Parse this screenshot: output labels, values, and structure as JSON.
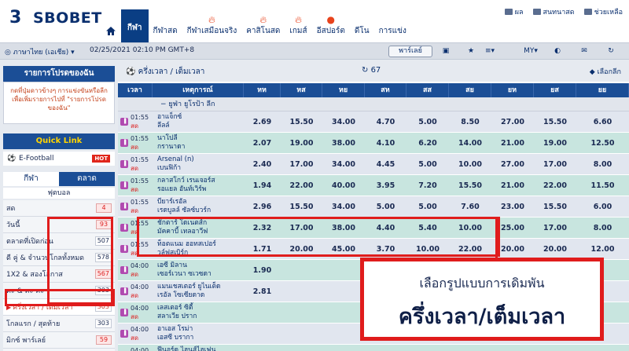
{
  "header": {
    "logo_mark": "3",
    "logo_text": "SBOBET",
    "nav": [
      {
        "label": "กีฬา",
        "active": true
      },
      {
        "label": "กีฬาสด"
      },
      {
        "label": "กีฬาเสมือนจริง",
        "fire": true
      },
      {
        "label": "คาสิโนสด",
        "fire": true
      },
      {
        "label": "เกมส์",
        "fire": true
      },
      {
        "label": "อีสปอร์ต",
        "fire": true
      },
      {
        "label": "ดีโน"
      },
      {
        "label": "การแข่ง"
      }
    ],
    "top_links": [
      "ผล",
      "สนทนาสด",
      "ช่วยเหลือ"
    ]
  },
  "subbar": {
    "language": "ภาษาไทย (เอเชีย)",
    "datetime": "02/25/2021 02:10 PM GMT+8",
    "parlay_label": "พาร์เลย์",
    "odds_type": "MY"
  },
  "sidebar": {
    "favorites_title": "รายการโปรดของฉัน",
    "favorites_note": "กดที่ปุ่มดาวข้างๆ การแข่งขันหรือลีกเพื่อเพิ่มรายการไปที่ \"รายการโปรดของฉัน\"",
    "quicklink_title": "Quick Link",
    "quicklink_item": "E-Football",
    "quicklink_badge": "HOT",
    "tab_sport": "กีฬา",
    "tab_market": "ตลาด",
    "sport_header": "ฟุตบอล",
    "markets": [
      {
        "label": "สด",
        "count": "4",
        "red": true
      },
      {
        "label": "วันนี้",
        "count": "93",
        "red": true
      },
      {
        "label": "ตลาดที่เปิดก่อน",
        "count": "507"
      },
      {
        "label": "ดี คู่ & จำนวนโกลทั้งหมด",
        "count": "578"
      },
      {
        "label": "1X2 & สองโอกาส",
        "count": "567",
        "red": true
      },
      {
        "label": "คะ & คะ คะ",
        "count": "303"
      },
      {
        "label": "ครึ่งเวลา / เต็มเวลา",
        "count": "303",
        "selected": true
      },
      {
        "label": "โกลแรก / สุดท้าย",
        "count": "303"
      },
      {
        "label": "มิกซ์ พาร์เลย์",
        "count": "59",
        "red": true
      },
      {
        "label": "ผลชนะเลิศ",
        "count": "18"
      }
    ]
  },
  "main": {
    "title": "ครึ่งเวลา / เต็มเวลา",
    "count": "67",
    "select_label": "เลือกลีก",
    "columns": [
      "เวลา",
      "เหตุการณ์",
      "หห",
      "หส",
      "หย",
      "สห",
      "สส",
      "สย",
      "ยห",
      "ยส",
      "ยย"
    ],
    "league": "ยูฟ่า ยูโรป้า ลีก",
    "rows": [
      {
        "time": "01:55",
        "live": "สด",
        "home": "อาแจ็กซ์",
        "away": "ลีลล์",
        "odds": [
          "2.69",
          "15.50",
          "34.00",
          "4.70",
          "5.00",
          "8.50",
          "27.00",
          "15.50",
          "6.60"
        ]
      },
      {
        "time": "01:55",
        "live": "สด",
        "home": "นาโปลี",
        "away": "กรานาดา",
        "odds": [
          "2.07",
          "19.00",
          "38.00",
          "4.10",
          "6.20",
          "14.00",
          "21.00",
          "19.00",
          "12.50"
        ]
      },
      {
        "time": "01:55",
        "live": "สด",
        "home": "Arsenal (n)",
        "away": "เบนฟิก้า",
        "odds": [
          "2.40",
          "17.00",
          "34.00",
          "4.45",
          "5.00",
          "10.00",
          "27.00",
          "17.00",
          "8.00"
        ]
      },
      {
        "time": "01:55",
        "live": "สด",
        "home": "กลาสโกว์ เรนเจอร์ส",
        "away": "รอแยล อันท์เวิร์พ",
        "odds": [
          "1.94",
          "22.00",
          "40.00",
          "3.95",
          "7.20",
          "15.50",
          "21.00",
          "22.00",
          "11.50"
        ]
      },
      {
        "time": "01:55",
        "live": "สด",
        "home": "บียาร์เรอัล",
        "away": "เรดบูลล์ ซัลซ์บวร์ก",
        "odds": [
          "2.96",
          "15.50",
          "34.00",
          "5.00",
          "5.00",
          "7.60",
          "23.00",
          "15.50",
          "6.00"
        ]
      },
      {
        "time": "01:55",
        "live": "สด",
        "home": "ชักตาร์ โดเนตส์ก",
        "away": "มัคคาบี้ เทลอาวีฟ",
        "odds": [
          "2.32",
          "17.00",
          "38.00",
          "4.40",
          "5.40",
          "10.00",
          "25.00",
          "17.00",
          "8.00"
        ]
      },
      {
        "time": "01:55",
        "live": "สด",
        "home": "ท็อตแนม ฮอทสเปอร์",
        "away": "วูล์ฟสเบิร์ก",
        "odds": [
          "1.71",
          "20.00",
          "45.00",
          "3.70",
          "10.00",
          "22.00",
          "20.00",
          "20.00",
          "12.00"
        ]
      },
      {
        "time": "04:00",
        "live": "สด",
        "home": "เอซี มิลาน",
        "away": "เซอร์เวนา ซเวซดา",
        "odds": [
          "1.90",
          "",
          "",
          "",
          "",
          "",
          "",
          "",
          ""
        ]
      },
      {
        "time": "04:00",
        "live": "สด",
        "home": "แมนเชสเตอร์ ยูไนเต็ด",
        "away": "เรอัล โซเซียดาด",
        "odds": [
          "2.81",
          "",
          "",
          "",
          "",
          "",
          "",
          "",
          ""
        ]
      },
      {
        "time": "04:00",
        "live": "สด",
        "home": "เลสเตอร์ ซิตี้",
        "away": "สลาเวีย ปราก",
        "odds": [
          "",
          "",
          "",
          "",
          "",
          "",
          "",
          "",
          ""
        ]
      },
      {
        "time": "04:00",
        "live": "สด",
        "home": "อาเอส โรม่า",
        "away": "เอสซี บรากา",
        "odds": [
          "",
          "",
          "",
          "",
          "",
          "",
          "",
          "",
          ""
        ]
      },
      {
        "time": "04:00",
        "live": "สด",
        "home": "ฟีนอร์ด ไฮนส์ไฮเฟน",
        "away": "โอลิมเปียโกส",
        "odds": [
          "2.62",
          "16.00",
          "34.00",
          "",
          "",
          "",
          "",
          "",
          ""
        ]
      }
    ]
  },
  "overlay": {
    "line1": "เลือกรูปแบบการเดิมพัน",
    "line2": "ครึ่งเวลา/เต็มเวลา"
  }
}
